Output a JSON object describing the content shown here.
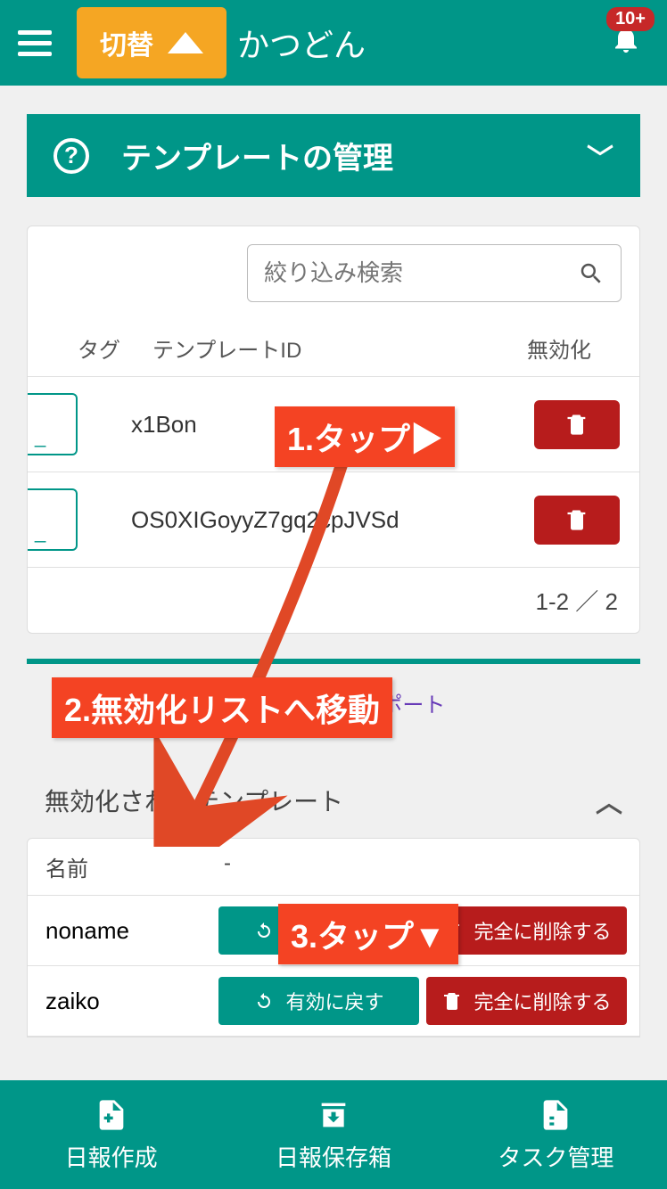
{
  "header": {
    "switch_label": "切替",
    "title": "かつどん",
    "badge": "10+"
  },
  "page": {
    "title": "テンプレートの管理"
  },
  "search": {
    "placeholder": "絞り込み検索"
  },
  "table": {
    "headers": {
      "tag": "タグ",
      "id": "テンプレートID",
      "disable": "無効化"
    },
    "rows": [
      {
        "id": "x1Bon"
      },
      {
        "id": "OS0XIGoyyZ7gq2cpJVSd"
      }
    ],
    "pager": "1-2 ／ 2"
  },
  "import_link": "旧NIPOからインポート",
  "disabled": {
    "title": "無効化されたテンプレート",
    "headers": {
      "name": "名前",
      "dash": "-"
    },
    "restore_label": "有効に戻す",
    "delete_label": "完全に削除する",
    "rows": [
      {
        "name": "noname"
      },
      {
        "name": "zaiko"
      }
    ]
  },
  "nav": {
    "create": "日報作成",
    "saved": "日報保存箱",
    "task": "タスク管理"
  },
  "annotations": {
    "a1": "1.タップ▶",
    "a2": "2.無効化リストへ移動",
    "a3": "3.タップ▼"
  }
}
